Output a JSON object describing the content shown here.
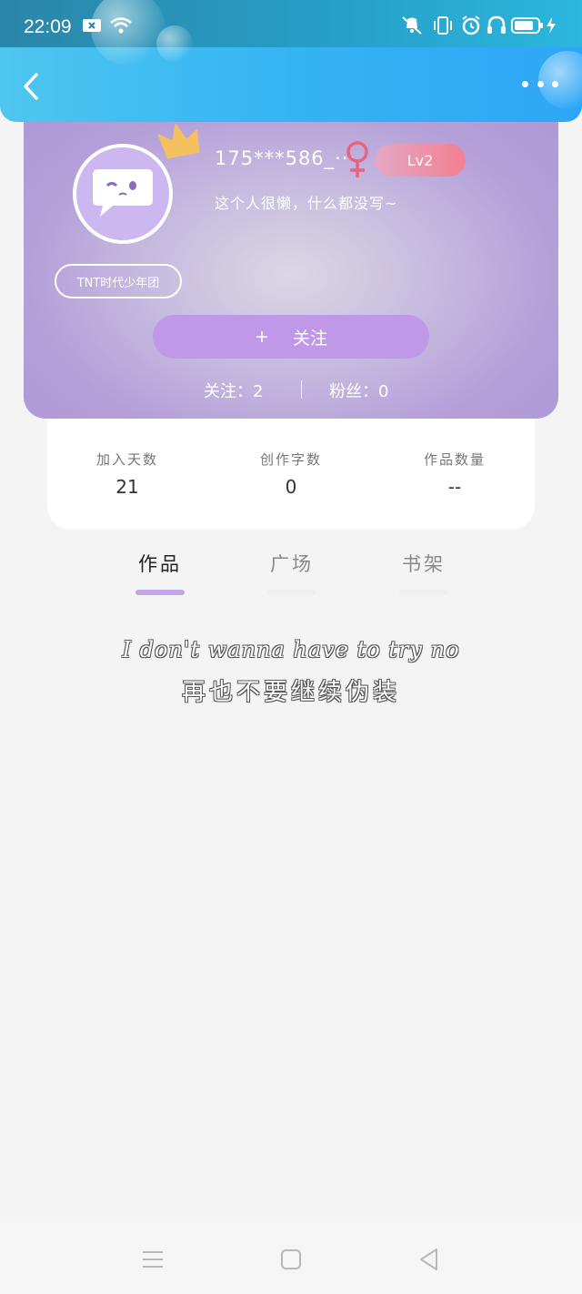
{
  "status_bar": {
    "time": "22:09"
  },
  "profile": {
    "username": "175***586_···",
    "level": "Lv2",
    "bio": "这个人很懒，什么都没写~",
    "group_tag": "TNT时代少年团",
    "follow_label": "关注",
    "follow_plus": "+",
    "following": "关注：2",
    "fans": "粉丝：0"
  },
  "stats": [
    {
      "label": "加入天数",
      "value": "21"
    },
    {
      "label": "创作字数",
      "value": "0"
    },
    {
      "label": "作品数量",
      "value": "--"
    }
  ],
  "tabs": [
    {
      "label": "作品",
      "active": true
    },
    {
      "label": "广场",
      "active": false
    },
    {
      "label": "书架",
      "active": false
    }
  ],
  "lyrics": {
    "line1": "I don't wanna have to try no",
    "line2": "再也不要继续伪装"
  },
  "colors": {
    "nav": "#35b4f3",
    "accent": "#c4a6e6",
    "level": "#f37f93",
    "follow_btn": "#bf98e8"
  }
}
